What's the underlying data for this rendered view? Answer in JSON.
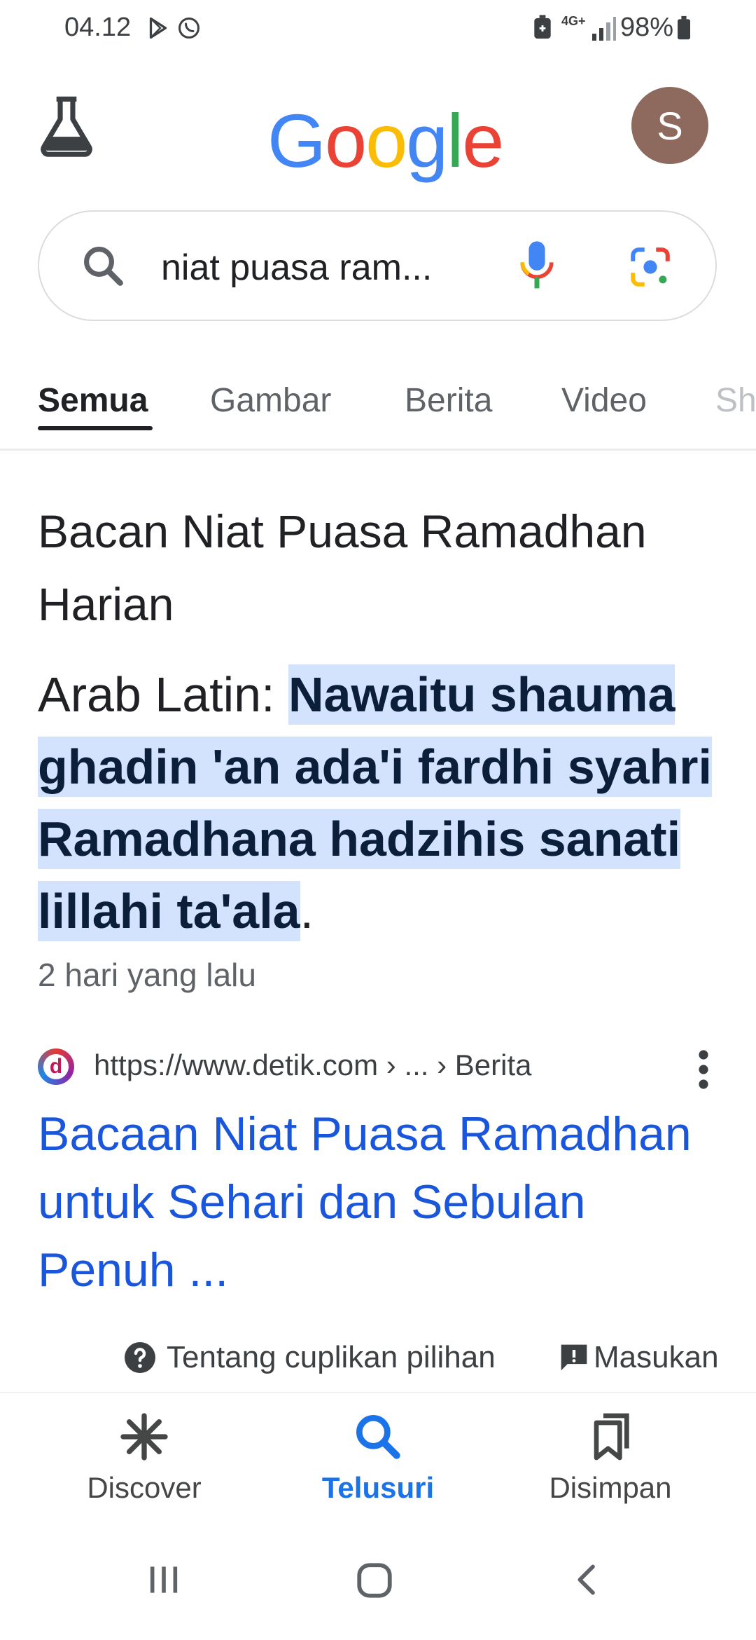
{
  "status_bar": {
    "time": "04.12",
    "network": "4G+",
    "battery": "98%",
    "icons": [
      "play-store-icon",
      "whatsapp-icon",
      "battery-saver-icon",
      "signal-icon",
      "battery-icon"
    ]
  },
  "header": {
    "labs_icon": "flask-icon",
    "logo_letters": [
      "G",
      "o",
      "o",
      "g",
      "l",
      "e"
    ],
    "avatar_initial": "S"
  },
  "search": {
    "query": "niat puasa ram...",
    "icons": [
      "search-icon",
      "mic-icon",
      "lens-icon"
    ]
  },
  "tabs": [
    {
      "label": "Semua",
      "active": true
    },
    {
      "label": "Gambar",
      "active": false
    },
    {
      "label": "Berita",
      "active": false
    },
    {
      "label": "Video",
      "active": false
    },
    {
      "label": "Sh",
      "active": false
    }
  ],
  "snippet": {
    "title": "Bacan Niat Puasa Ramadhan Harian",
    "prefix": "Arab Latin: ",
    "highlight": "Nawaitu shauma ghadin 'an ada'i fardhi syahri Ramadhana hadzihis sanati lillahi ta'ala",
    "suffix": ".",
    "date": "2 hari yang lalu"
  },
  "source": {
    "favicon_letter": "d",
    "url": "https://www.detik.com › ... › Berita",
    "link_title": "Bacaan Niat Puasa Ramadhan untuk Sehari dan Sebulan Penuh ..."
  },
  "footer_links": {
    "about": "Tentang cuplikan pilihan",
    "feedback": "Masukan"
  },
  "bottom_nav": [
    {
      "label": "Discover",
      "icon": "asterisk-icon",
      "active": false
    },
    {
      "label": "Telusuri",
      "icon": "search-icon",
      "active": true
    },
    {
      "label": "Disimpan",
      "icon": "bookmarks-icon",
      "active": false
    }
  ],
  "colors": {
    "google_blue": "#4285f4",
    "google_red": "#ea4335",
    "google_yellow": "#fbbc05",
    "google_green": "#34a853",
    "link_blue": "#1a56db",
    "highlight_bg": "#d3e3fd",
    "avatar_bg": "#8d6a5d"
  }
}
